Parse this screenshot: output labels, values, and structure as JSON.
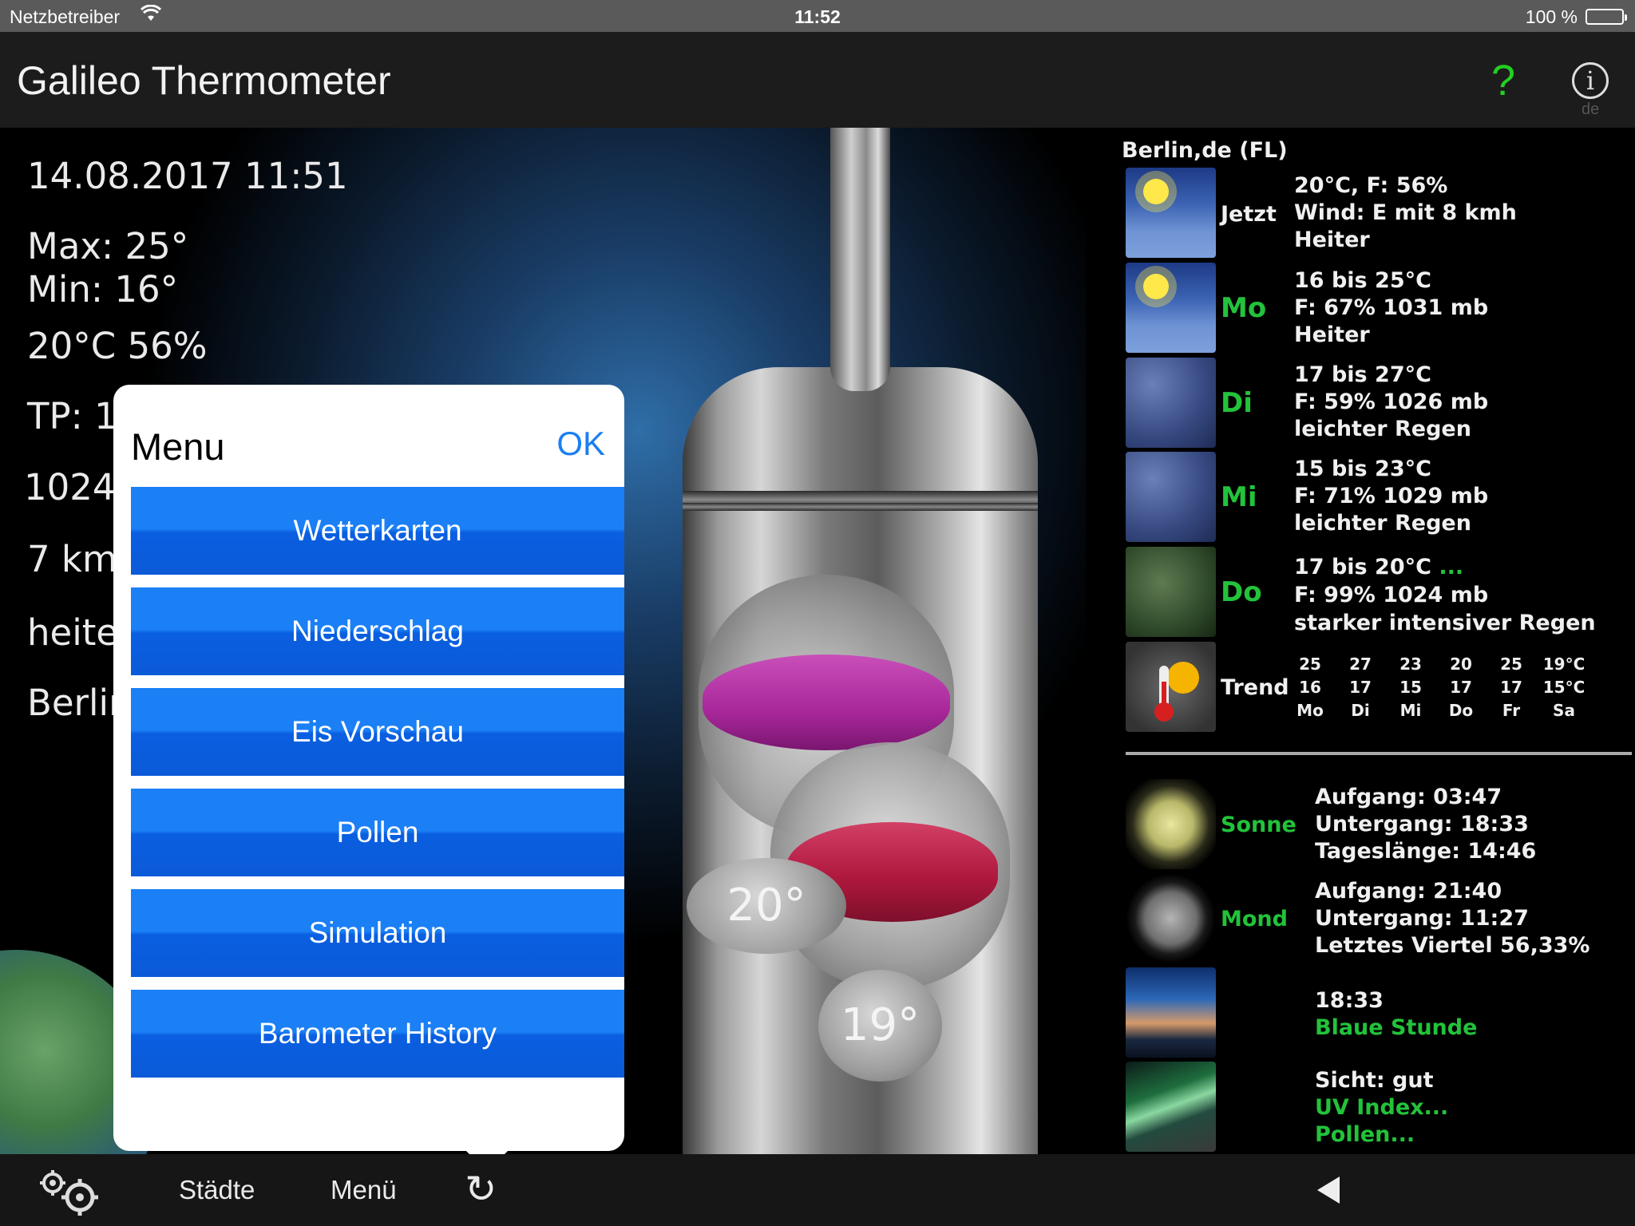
{
  "status_bar": {
    "carrier": "Netzbetreiber",
    "time": "11:52",
    "battery": "100 %"
  },
  "nav": {
    "title": "Galileo Thermometer",
    "help_label": "?",
    "info_label": "i",
    "lang": "de"
  },
  "left_info": {
    "datetime": "14.08.2017 11:51",
    "max": "Max: 25°",
    "min": "Min: 16°",
    "current": "20°C 56%",
    "tp": "TP: 1",
    "pressure": "1024",
    "wind": "7 km",
    "condition": "heite",
    "city": "Berlir"
  },
  "thermometer": {
    "tag_upper": "20°",
    "tag_lower": "19°"
  },
  "forecast": {
    "location": "Berlin,de (FL)",
    "now": {
      "label": "Jetzt",
      "line1": "20°C, F: 56%",
      "line2": "Wind: E mit 8 kmh",
      "line3": "Heiter"
    },
    "days": [
      {
        "day": "Mo",
        "line1": "16 bis 25°C",
        "line2": "F: 67% 1031 mb",
        "line3": "Heiter"
      },
      {
        "day": "Di",
        "line1": "17 bis 27°C",
        "line2": "F: 59% 1026 mb",
        "line3": "leichter Regen"
      },
      {
        "day": "Mi",
        "line1": "15 bis 23°C",
        "line2": "F: 71% 1029 mb",
        "line3": "leichter Regen"
      },
      {
        "day": "Do",
        "line1": "17 bis 20°C",
        "more": "...",
        "line2": "F: 99% 1024 mb",
        "line3": "starker intensiver Regen"
      }
    ],
    "trend": {
      "label": "Trend",
      "columns": [
        {
          "high": "25",
          "low": "16",
          "day": "Mo"
        },
        {
          "high": "27",
          "low": "17",
          "day": "Di"
        },
        {
          "high": "23",
          "low": "15",
          "day": "Mi"
        },
        {
          "high": "20",
          "low": "17",
          "day": "Do"
        },
        {
          "high": "25",
          "low": "17",
          "day": "Fr"
        },
        {
          "high": "19°C",
          "low": "15°C",
          "day": "Sa"
        }
      ]
    }
  },
  "astro": {
    "sun": {
      "label": "Sonne",
      "rise": "Aufgang: 03:47",
      "set": "Untergang: 18:33",
      "length": "Tageslänge: 14:46"
    },
    "moon": {
      "label": "Mond",
      "rise": "Aufgang: 21:40",
      "set": "Untergang: 11:27",
      "phase": "Letztes Viertel 56,33%"
    },
    "blue_hour": {
      "time": "18:33",
      "label": "Blaue Stunde"
    },
    "extra": {
      "visibility": "Sicht: gut",
      "uv": "UV Index...",
      "pollen": "Pollen..."
    }
  },
  "menu": {
    "title": "Menu",
    "ok_label": "OK",
    "items": [
      "Wetterkarten",
      "Niederschlag",
      "Eis Vorschau",
      "Pollen",
      "Simulation",
      "Barometer History"
    ]
  },
  "toolbar": {
    "cities_label": "Städte",
    "menu_label": "Menü",
    "refresh_icon": "↻"
  },
  "colors": {
    "accent_green": "#22c33a",
    "menu_blue": "#1b7ff6",
    "ok_blue": "#1a7ff2"
  }
}
